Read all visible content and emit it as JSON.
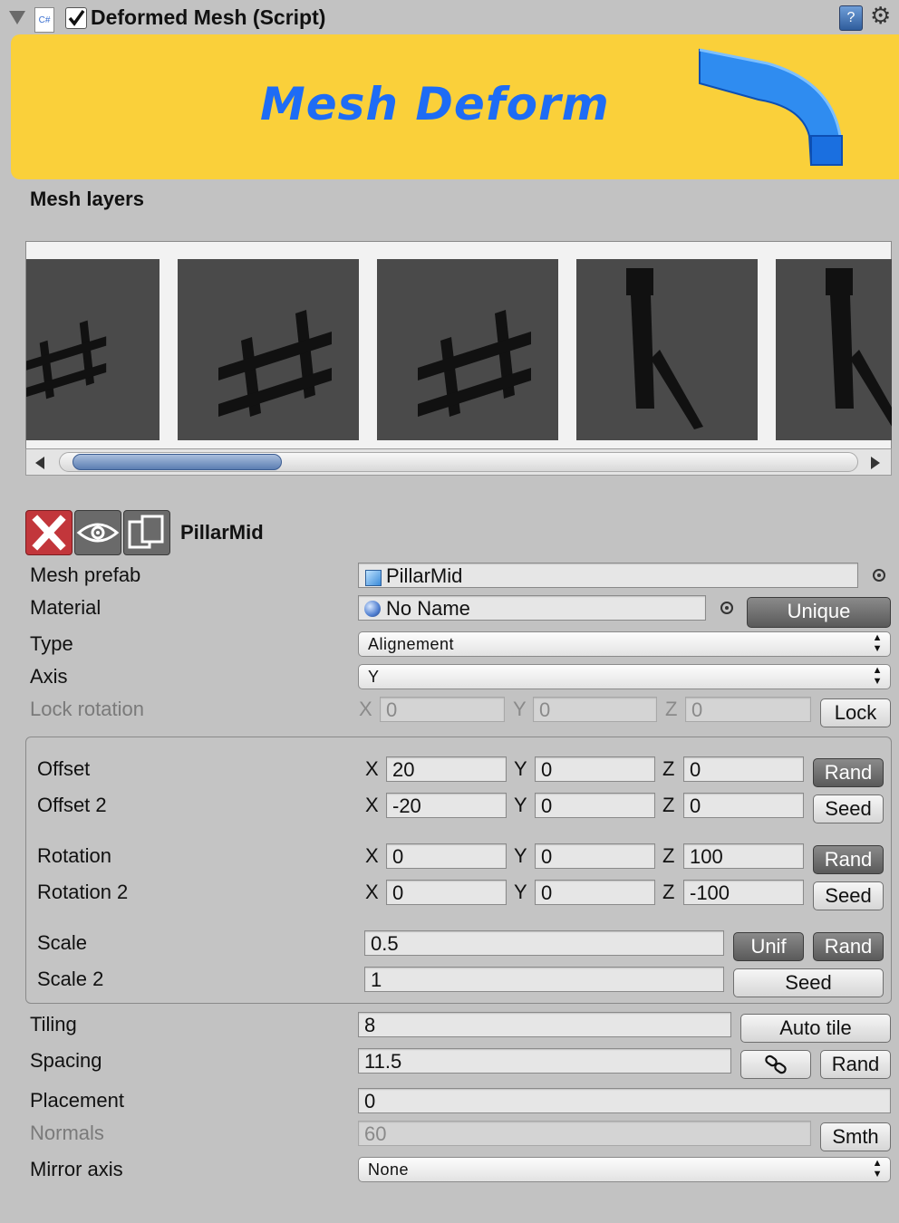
{
  "header": {
    "title": "Deformed Mesh (Script)",
    "enabled": true
  },
  "banner": {
    "logo_text": "Mesh Deform",
    "bg_color": "#fad03a",
    "logo_color": "#1e6cf5"
  },
  "mesh_layers": {
    "title": "Mesh layers",
    "thumbnails": [
      "fence",
      "fence",
      "fence",
      "pillar",
      "pillar"
    ]
  },
  "selected_layer": {
    "name": "PillarMid"
  },
  "fields": {
    "mesh_prefab": {
      "label": "Mesh prefab",
      "value": "PillarMid"
    },
    "material": {
      "label": "Material",
      "value": "No Name",
      "button": "Unique"
    },
    "type": {
      "label": "Type",
      "value": "Alignement"
    },
    "axis": {
      "label": "Axis",
      "value": "Y"
    },
    "lock_rotation": {
      "label": "Lock rotation",
      "x": "0",
      "y": "0",
      "z": "0",
      "button": "Lock"
    }
  },
  "transform": {
    "offset": {
      "label": "Offset",
      "x": "20",
      "y": "0",
      "z": "0",
      "button": "Rand"
    },
    "offset2": {
      "label": "Offset 2",
      "x": "-20",
      "y": "0",
      "z": "0",
      "button": "Seed"
    },
    "rotation": {
      "label": "Rotation",
      "x": "0",
      "y": "0",
      "z": "100",
      "button": "Rand"
    },
    "rotation2": {
      "label": "Rotation 2",
      "x": "0",
      "y": "0",
      "z": "-100",
      "button": "Seed"
    },
    "scale": {
      "label": "Scale",
      "value": "0.5",
      "button1": "Unif",
      "button2": "Rand"
    },
    "scale2": {
      "label": "Scale 2",
      "value": "1",
      "button": "Seed"
    }
  },
  "bottom": {
    "tiling": {
      "label": "Tiling",
      "value": "8",
      "button": "Auto tile"
    },
    "spacing": {
      "label": "Spacing",
      "value": "11.5",
      "button": "Rand"
    },
    "placement": {
      "label": "Placement",
      "value": "0"
    },
    "normals": {
      "label": "Normals",
      "value": "60",
      "button": "Smth"
    },
    "mirror_axis": {
      "label": "Mirror axis",
      "value": "None"
    }
  },
  "axis_letters": {
    "x": "X",
    "y": "Y",
    "z": "Z"
  },
  "scroll": {
    "position_fraction": 0.0,
    "visible_fraction": 0.27
  }
}
